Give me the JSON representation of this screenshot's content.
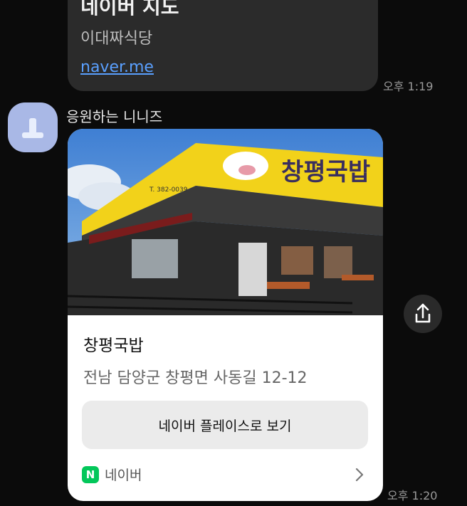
{
  "previous_message": {
    "title": "네이버 지도",
    "subtitle": "이대짜식당",
    "link": "naver.me",
    "time": "오후 1:19"
  },
  "message": {
    "sender": "응원하는 니니즈",
    "time": "오후 1:20",
    "card": {
      "photo_sign": "창평국밥",
      "photo_phone": "T. 382-0039",
      "title": "창평국밥",
      "address": "전남 담양군 창평면 사동길 12-12",
      "button_label": "네이버 플레이스로 보기",
      "provider_logo": "N",
      "provider": "네이버"
    }
  },
  "colors": {
    "background": "#0b0b0b",
    "avatar": "#a9b8e6",
    "link": "#5aa0ff",
    "naver_green": "#03c75a"
  }
}
